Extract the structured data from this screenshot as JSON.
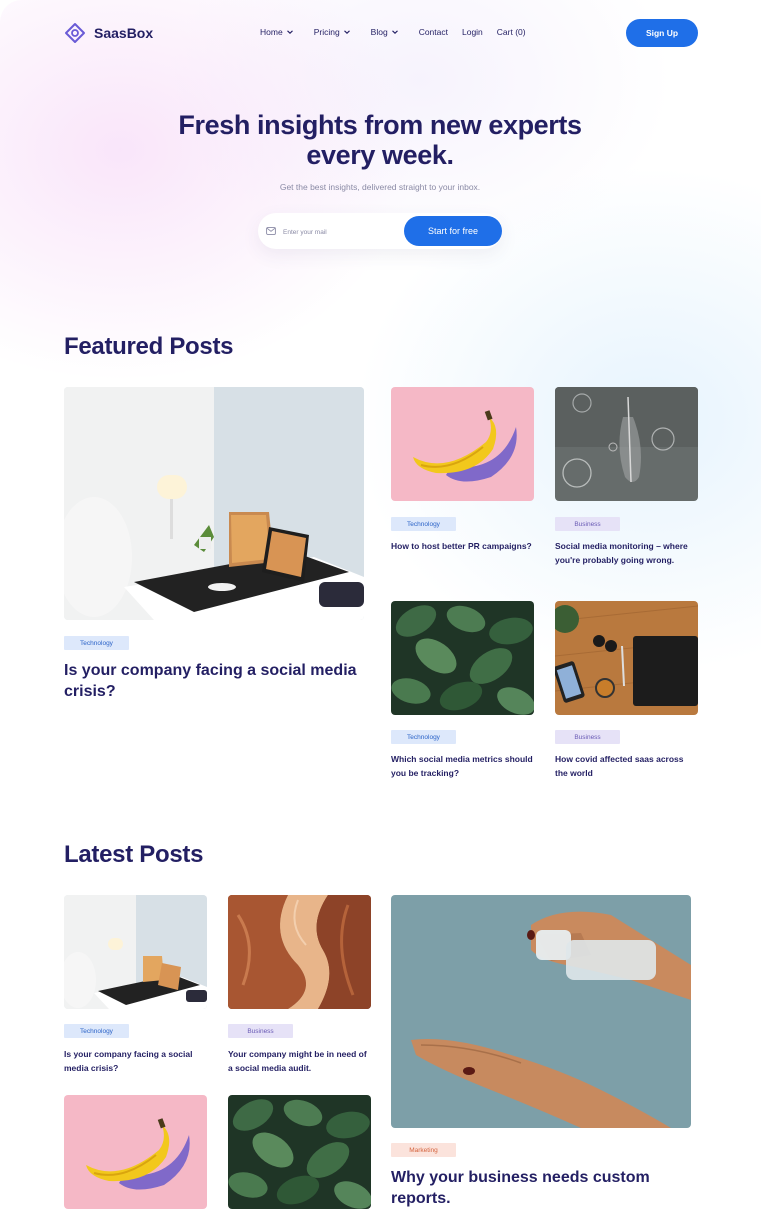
{
  "brand": {
    "name": "SaasBox",
    "accent": "#1f6fe8",
    "heading_color": "#231f63"
  },
  "nav": {
    "items": [
      {
        "label": "Home",
        "dropdown": true
      },
      {
        "label": "Pricing",
        "dropdown": true
      },
      {
        "label": "Blog",
        "dropdown": true
      },
      {
        "label": "Contact",
        "dropdown": false
      },
      {
        "label": "Login",
        "dropdown": false
      },
      {
        "label": "Cart (0)",
        "dropdown": false
      }
    ],
    "signup_label": "Sign Up"
  },
  "hero": {
    "title_line1": "Fresh insights from new experts",
    "title_line2": "every week.",
    "subtitle": "Get the best insights, delivered straight to your inbox.",
    "email_placeholder": "Enter your mail",
    "email_value": "",
    "cta_label": "Start for free"
  },
  "featured": {
    "heading": "Featured Posts",
    "main": {
      "tag": "Technology",
      "title": "Is your company facing a social media crisis?",
      "image": "desk-laptop"
    },
    "posts": [
      {
        "tag": "Technology",
        "title": "How to host better PR campaigns?",
        "image": "banana-pink"
      },
      {
        "tag": "Business",
        "title": "Social media monitoring – where you're probably going wrong.",
        "image": "violin-bubbles"
      },
      {
        "tag": "Technology",
        "title": "Which social media metrics should you be tracking?",
        "image": "green-leaves"
      },
      {
        "tag": "Business",
        "title": "How covid affected saas across the world",
        "image": "wood-desk-flatlay"
      }
    ]
  },
  "latest": {
    "heading": "Latest Posts",
    "posts": [
      {
        "tag": "Technology",
        "title": "Is your company facing a social media crisis?",
        "image": "desk-laptop"
      },
      {
        "tag": "Business",
        "title": "Your company might be in need of a social media audit.",
        "image": "canyon"
      },
      {
        "tag": "",
        "title": "",
        "image": "banana-pink"
      },
      {
        "tag": "",
        "title": "",
        "image": "green-leaves"
      }
    ],
    "main": {
      "tag": "Marketing",
      "title": "Why your business needs custom reports.",
      "image": "hand-spray"
    }
  },
  "colors": {
    "tag_technology_bg": "#dde8fb",
    "tag_business_bg": "#e6e2f7",
    "tag_marketing_bg": "#fbe3dc"
  }
}
